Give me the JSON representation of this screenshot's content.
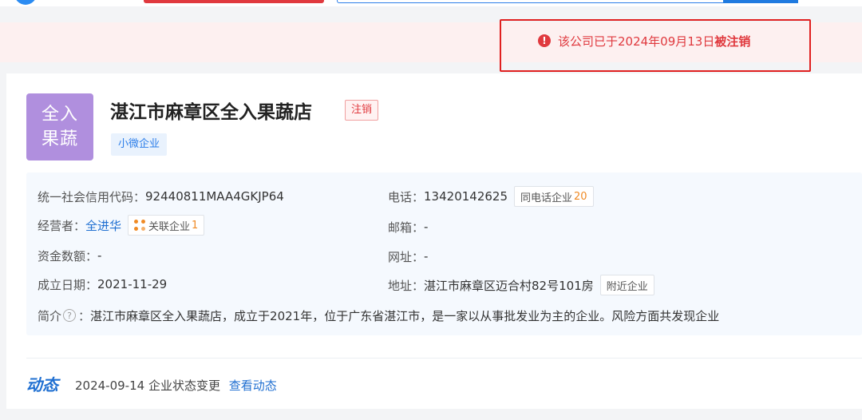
{
  "banner": {
    "prefix": "该公司已于2024年09月13日",
    "status_strong": "被注销",
    "icon": "alert-circle-icon",
    "color": "#e0393e"
  },
  "company": {
    "logo_line1": "全入",
    "logo_line2": "果蔬",
    "logo_color": "#b08fde",
    "name": "湛江市麻章区全入果蔬店",
    "status_tag": "注销",
    "scale_tag": "小微企业"
  },
  "info": {
    "credit_code_label": "统一社会信用代码：",
    "credit_code": "92440811MAA4GKJP64",
    "phone_label": "电话：",
    "phone": "13420142625",
    "same_phone_label": "同电话企业",
    "same_phone_count": "20",
    "operator_label": "经营者：",
    "operator": "全进华",
    "related_label": "关联企业",
    "related_count": "1",
    "email_label": "邮箱：",
    "email": "-",
    "capital_label": "资金数额：",
    "capital": "-",
    "website_label": "网址：",
    "website": "-",
    "founded_label": "成立日期：",
    "founded": "2021-11-29",
    "address_label": "地址：",
    "address": "湛江市麻章区迈合村82号101房",
    "nearby_label": "附近企业",
    "intro_label": "简介",
    "intro_help": "?",
    "intro_sep": "：",
    "intro": "湛江市麻章区全入果蔬店，成立于2021年，位于广东省湛江市，是一家以从事批发业为主的企业。风险方面共发现企业"
  },
  "dynamics": {
    "title": "动态",
    "date": "2024-09-14",
    "event": "企业状态变更",
    "link": "查看动态"
  }
}
